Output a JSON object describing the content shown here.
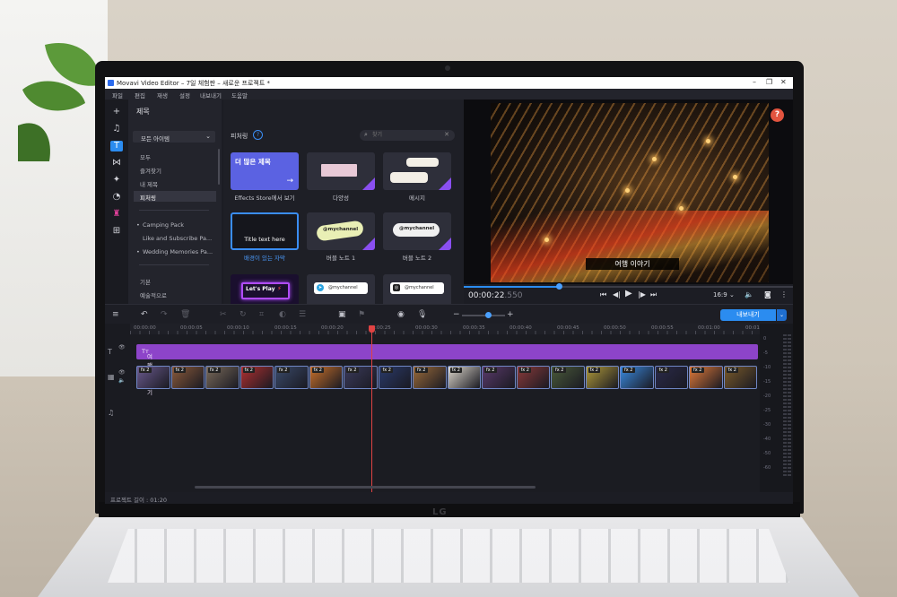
{
  "window": {
    "title": "Movavi Video Editor – 7일 체험판 – 새로운 프로젝트 *",
    "controls": [
      "–",
      "❐",
      "✕"
    ]
  },
  "menu": [
    "파일",
    "편집",
    "재생",
    "설정",
    "내보내기",
    "도움말"
  ],
  "tools": [
    {
      "name": "import-icon",
      "glyph": "+"
    },
    {
      "name": "music-icon",
      "glyph": "♫"
    },
    {
      "name": "titles-icon",
      "glyph": "T"
    },
    {
      "name": "transitions-icon",
      "glyph": "⋈"
    },
    {
      "name": "effects-icon",
      "glyph": "✦"
    },
    {
      "name": "filters-icon",
      "glyph": "◔"
    },
    {
      "name": "stickers-icon",
      "glyph": "♜"
    },
    {
      "name": "more-tools-icon",
      "glyph": "⊞"
    }
  ],
  "left_panel": {
    "title": "제목",
    "dropdown": "모든 아이템",
    "categories": [
      "모두",
      "즐겨찾기",
      "내 제목",
      "피처링"
    ],
    "packs": [
      "Camping Pack",
      "Like and Subscribe Pa...",
      "Wedding Memories Pa..."
    ],
    "more": [
      "기본",
      "예술적으로"
    ]
  },
  "grid": {
    "header": "피처링",
    "search_placeholder": "찾기",
    "tiles": [
      {
        "caption": "Effects Store에서 보기",
        "label": "더 많은 제목"
      },
      {
        "caption": "다양성"
      },
      {
        "caption": "메시지"
      },
      {
        "caption": "배경이 있는 자막",
        "label": "Title text here"
      },
      {
        "caption": "버블 노트 1",
        "label": "@mychannel"
      },
      {
        "caption": "버블 노트 2",
        "label": "@mychannel"
      },
      {
        "caption": "",
        "label": "Let's Play"
      },
      {
        "caption": "",
        "label": "@mychannel"
      },
      {
        "caption": "",
        "label": "@mychannel"
      }
    ]
  },
  "preview": {
    "subtitle": "여행 이야기",
    "time_main": "00:00:22",
    "time_ms": ".550",
    "aspect": "16:9",
    "progress": 0.29
  },
  "timeline": {
    "export_label": "내보내기",
    "ruler": [
      "00:00:00",
      "00:00:05",
      "00:00:10",
      "00:00:15",
      "00:00:20",
      "00:00:25",
      "00:00:30",
      "00:00:35",
      "00:00:40",
      "00:00:45",
      "00:00:50",
      "00:00:55",
      "00:01:00",
      "00:01:05"
    ],
    "title_clip": "여행 이야기",
    "fx_label": "fx 2",
    "clip_colors": [
      "#6a5a8e",
      "#8b5a3a",
      "#7a6a5a",
      "#b03030",
      "#3a4a6a",
      "#c8702a",
      "#3a3a5a",
      "#2a3a6a",
      "#9a6a3a",
      "#ddd7cc",
      "#5a3a6a",
      "#8a3a3a",
      "#4a5a3a",
      "#b09a3a",
      "#3a8ae0",
      "#2a2a4a",
      "#e07a3a",
      "#7a5a2a"
    ],
    "meter_labels": [
      "0",
      "-5",
      "-10",
      "-15",
      "-20",
      "-25",
      "-30",
      "-40",
      "-50",
      "-60"
    ]
  },
  "status": {
    "project_length": "프로젝트 길이 : 01:20"
  }
}
